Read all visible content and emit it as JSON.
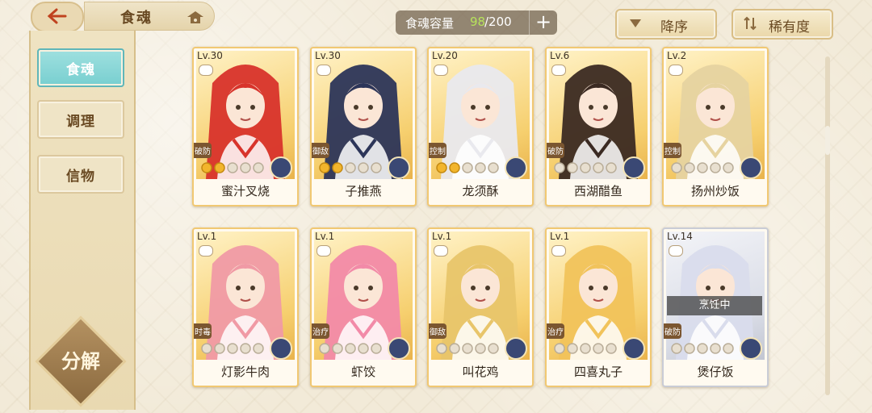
{
  "header": {
    "title": "食魂",
    "capacity_label": "食魂容量",
    "capacity_count": "98",
    "capacity_total": "/200",
    "plus_label": "+",
    "sort_desc_label": "降序",
    "sort_rarity_label": "稀有度"
  },
  "sidebar": {
    "items": [
      {
        "label": "食魂",
        "active": true
      },
      {
        "label": "调理",
        "active": false
      },
      {
        "label": "信物",
        "active": false
      }
    ],
    "split_label": "分解"
  },
  "cards": [
    {
      "level": "Lv.30",
      "role": "破防",
      "name": "蜜汁叉烧",
      "stars": 2,
      "hair": "#d8332b",
      "frame": "gold"
    },
    {
      "level": "Lv.30",
      "role": "御敌",
      "name": "子推燕",
      "stars": 2,
      "hair": "#2c3559",
      "frame": "gold"
    },
    {
      "level": "Lv.20",
      "role": "控制",
      "name": "龙须酥",
      "stars": 2,
      "hair": "#e9e9ee",
      "frame": "gold"
    },
    {
      "level": "Lv.6",
      "role": "破防",
      "name": "西湖醋鱼",
      "stars": 0,
      "hair": "#3b2a22",
      "frame": "gold"
    },
    {
      "level": "Lv.2",
      "role": "控制",
      "name": "扬州炒饭",
      "stars": 0,
      "hair": "#e6d3a0",
      "frame": "gold"
    },
    {
      "level": "Lv.1",
      "role": "时毒",
      "name": "灯影牛肉",
      "stars": 0,
      "hair": "#f09aa5",
      "frame": "gold"
    },
    {
      "level": "Lv.1",
      "role": "治疗",
      "name": "虾饺",
      "stars": 0,
      "hair": "#f28aa8",
      "frame": "gold"
    },
    {
      "level": "Lv.1",
      "role": "御敌",
      "name": "叫花鸡",
      "stars": 0,
      "hair": "#e8c56a",
      "frame": "gold"
    },
    {
      "level": "Lv.1",
      "role": "治疗",
      "name": "四喜丸子",
      "stars": 0,
      "hair": "#f1c35b",
      "frame": "gold"
    },
    {
      "level": "Lv.14",
      "role": "破防",
      "name": "煲仔饭",
      "stars": 0,
      "hair": "#d9dcec",
      "frame": "silver",
      "status": "烹饪中"
    }
  ]
}
